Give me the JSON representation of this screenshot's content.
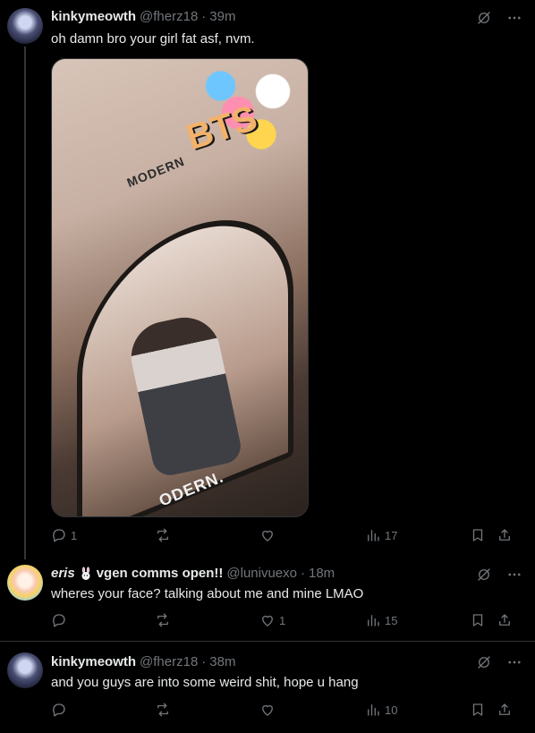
{
  "tweets": [
    {
      "name": "kinkymeowth",
      "handle": "@fherz18",
      "dot": "·",
      "time": "39m",
      "text": "oh damn bro your girl fat asf, nvm.",
      "media": {
        "sticker_text": "BTS",
        "mirror_text_top": "MODERN",
        "mirror_text_bottom": "ODERN."
      },
      "replies": "1",
      "retweets": "",
      "likes": "",
      "views": "17"
    },
    {
      "name": "eris",
      "name_suffix": "vgen comms open!!",
      "handle": "@lunivuexo",
      "dot": "·",
      "time": "18m",
      "text": "wheres your face? talking about me and mine LMAO",
      "replies": "",
      "retweets": "",
      "likes": "1",
      "views": "15"
    },
    {
      "name": "kinkymeowth",
      "handle": "@fherz18",
      "dot": "·",
      "time": "38m",
      "text": "and you guys are into some weird shit, hope u hang",
      "replies": "",
      "retweets": "",
      "likes": "",
      "views": "10"
    }
  ],
  "icons": {
    "grok": "grok-icon",
    "more": "more-icon",
    "reply": "reply-icon",
    "retweet": "retweet-icon",
    "like": "heart-icon",
    "views": "views-icon",
    "bookmark": "bookmark-icon",
    "share": "share-icon"
  },
  "colors": {
    "background": "#000000",
    "text": "#e7e9ea",
    "muted": "#71767b",
    "divider": "#2f3336"
  }
}
